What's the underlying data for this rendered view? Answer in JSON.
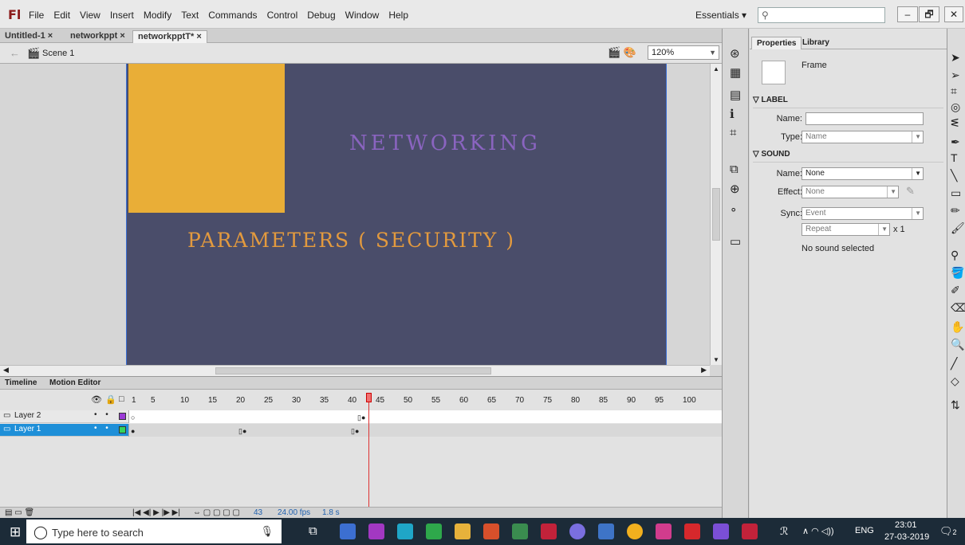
{
  "app": {
    "logo": "Fl"
  },
  "menu": [
    "File",
    "Edit",
    "View",
    "Insert",
    "Modify",
    "Text",
    "Commands",
    "Control",
    "Debug",
    "Window",
    "Help"
  ],
  "workspace": "Essentials ▾",
  "window_buttons": [
    "–",
    "🗗",
    "✕"
  ],
  "doc_tabs": [
    "Untitled-1 ×",
    "networkppt ×",
    "networkpptT* ×"
  ],
  "scene": {
    "label": "Scene 1",
    "zoom": "120%"
  },
  "stage": {
    "text1": "NETWORKING",
    "text2": "PARAMETERS ( SECURITY )"
  },
  "timeline": {
    "tabs": [
      "Timeline",
      "Motion Editor"
    ],
    "ruler": [
      "1",
      "5",
      "10",
      "15",
      "20",
      "25",
      "30",
      "35",
      "40",
      "45",
      "50",
      "55",
      "60",
      "65",
      "70",
      "75",
      "80",
      "85",
      "90",
      "95",
      "100"
    ],
    "layers": [
      {
        "name": "Layer 2",
        "dots": "• •"
      },
      {
        "name": "Layer 1",
        "dots": "• •"
      }
    ],
    "status": {
      "frame": "43",
      "fps": "24.00 fps",
      "time": "1.8 s"
    }
  },
  "properties": {
    "tabs": [
      "Properties",
      "Library"
    ],
    "frame_label": "Frame",
    "label_section": "LABEL",
    "sound_section": "SOUND",
    "name_label": "Name:",
    "type_label": "Type:",
    "type_value": "Name",
    "sound_name_label": "Name:",
    "sound_name_value": "None",
    "effect_label": "Effect:",
    "effect_value": "None",
    "sync_label": "Sync:",
    "sync_value": "Event",
    "repeat_value": "Repeat",
    "repeat_count": "x 1",
    "status": "No sound selected"
  },
  "taskbar": {
    "search_placeholder": "Type here to search",
    "lang": "ENG",
    "time": "23:01",
    "date": "27-03-2019",
    "notifications": "2"
  }
}
